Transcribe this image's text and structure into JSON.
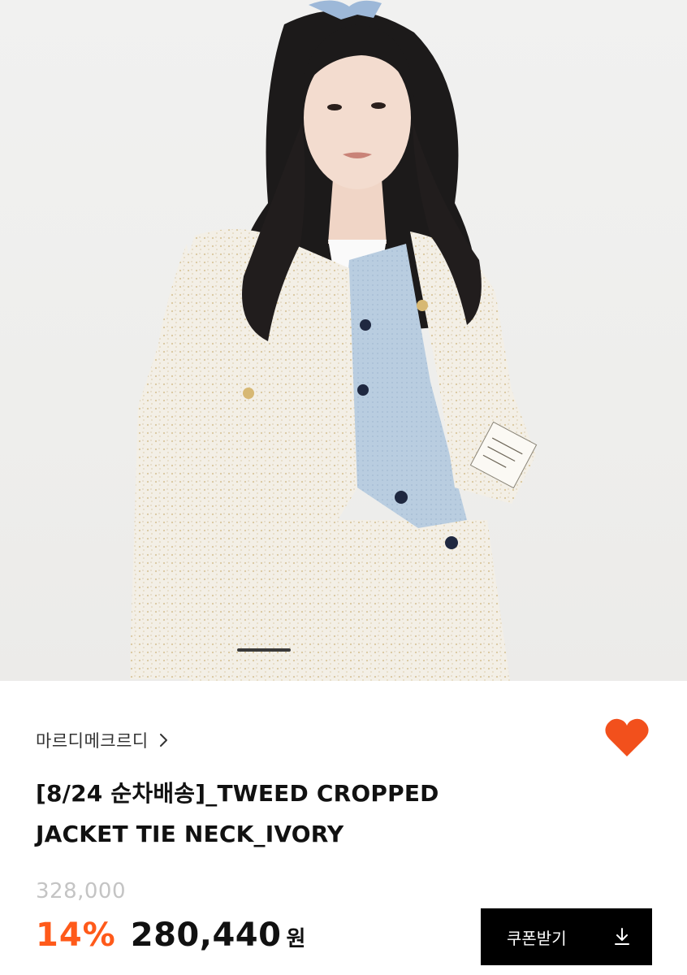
{
  "product_image": {
    "icon": "product-photo",
    "alt": "model wearing tweed cropped jacket"
  },
  "brand": {
    "name": "마르디메크르디",
    "chevron_icon": "chevron-right-icon"
  },
  "wishlist": {
    "icon": "heart-icon",
    "color": "#f2501c"
  },
  "product": {
    "title_line1": "[8/24 순차배송]_TWEED CROPPED",
    "title_line2": "JACKET TIE NECK_IVORY"
  },
  "price": {
    "original": "328,000",
    "discount": "14%",
    "sale": "280,440",
    "currency": "원",
    "discount_color": "#ff5a1a"
  },
  "coupon_button": {
    "label": "쿠폰받기",
    "icon": "download-icon"
  }
}
